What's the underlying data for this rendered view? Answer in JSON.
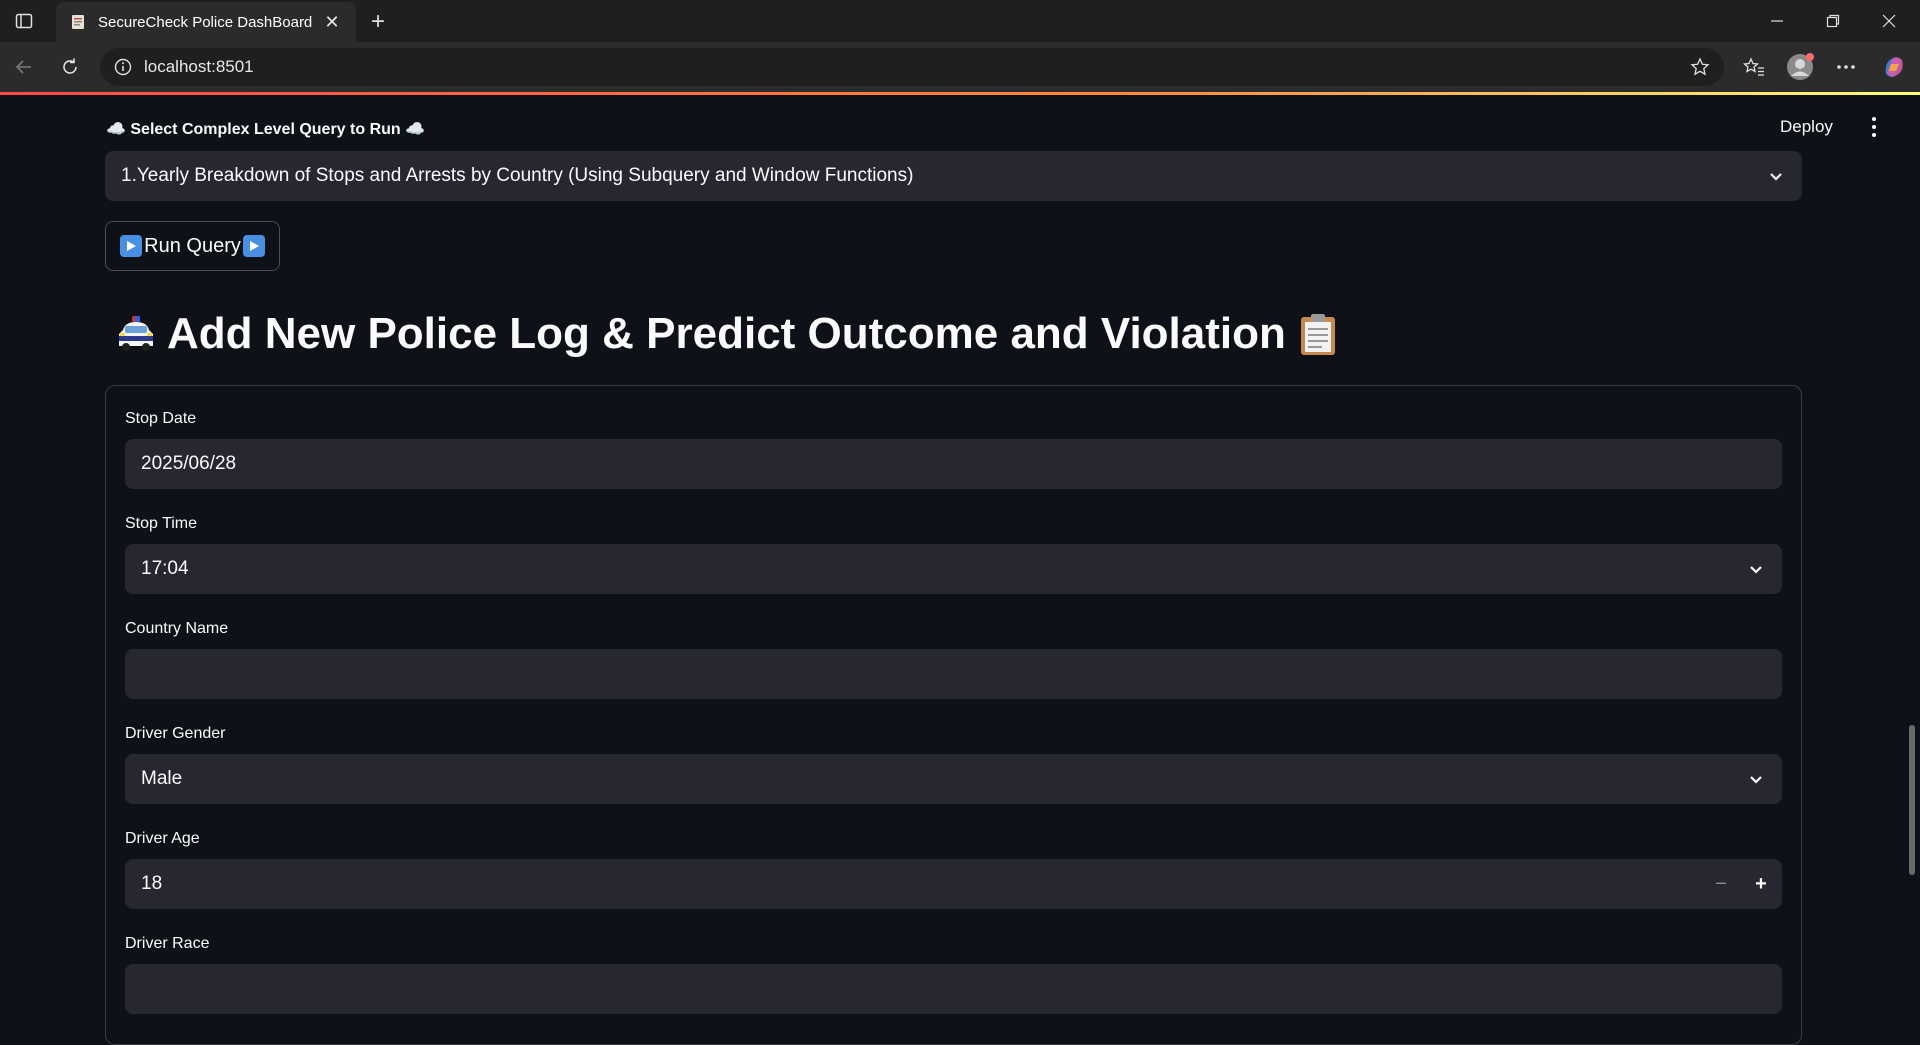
{
  "browser": {
    "tab_title": "SecureCheck Police DashBoard",
    "url": "localhost:8501"
  },
  "app": {
    "deploy_label": "Deploy",
    "query_label": "☁️ Select Complex Level Query to Run ☁️",
    "query_selected": "1.Yearly Breakdown of Stops and Arrests by Country (Using Subquery and Window Functions)",
    "run_label": "Run Query",
    "heading": "Add New Police Log & Predict Outcome and Violation"
  },
  "form": {
    "stop_date": {
      "label": "Stop Date",
      "value": "2025/06/28"
    },
    "stop_time": {
      "label": "Stop Time",
      "value": "17:04"
    },
    "country": {
      "label": "Country Name",
      "value": ""
    },
    "gender": {
      "label": "Driver Gender",
      "value": "Male"
    },
    "age": {
      "label": "Driver Age",
      "value": "18"
    },
    "race": {
      "label": "Driver Race",
      "value": ""
    }
  },
  "icons": {
    "accent": "#ff4b4b",
    "play_color": "#4a90e2"
  }
}
